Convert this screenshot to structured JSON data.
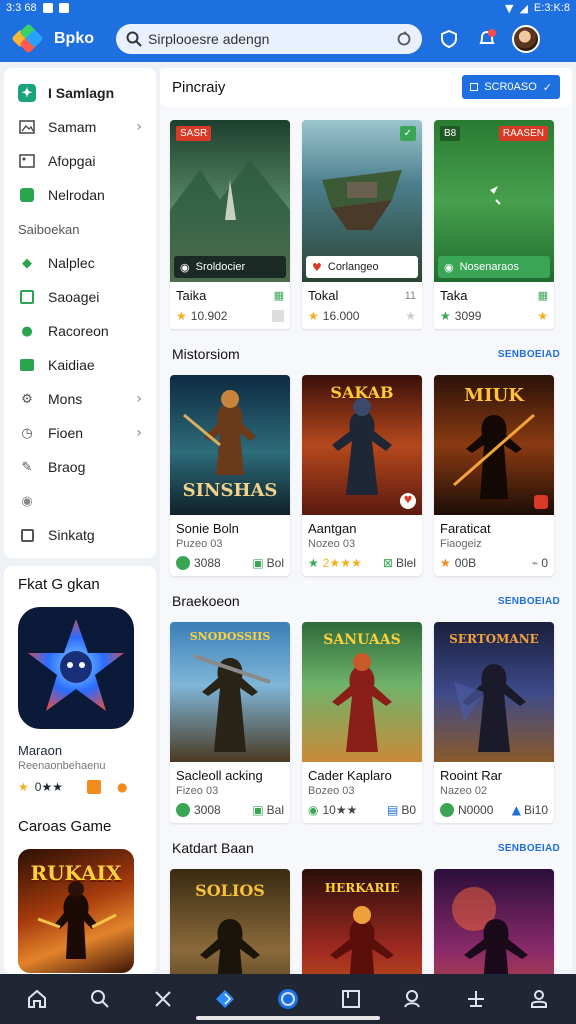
{
  "status_bar": {
    "time": "3:3 68",
    "right_text": "E:3:K:8"
  },
  "app": {
    "name": "Bpko",
    "search": {
      "value": "Sirplooesre adengn"
    }
  },
  "sidebar": {
    "items": [
      {
        "label": "I Samlagn",
        "icon": "home-grid-icon"
      },
      {
        "label": "Samam",
        "icon": "image-icon",
        "chevron": true
      },
      {
        "label": "Afopgai",
        "icon": "gallery-icon"
      },
      {
        "label": "Nelrodan",
        "icon": "green-square-icon"
      }
    ],
    "section_heading": "Saiboekan",
    "items2": [
      {
        "label": "Nalplec",
        "icon": "leaf-icon"
      },
      {
        "label": "Saoagei",
        "icon": "chart-icon"
      },
      {
        "label": "Racoreon",
        "icon": "refresh-icon"
      },
      {
        "label": "Kaidiae",
        "icon": "bar-icon"
      },
      {
        "label": "Mons",
        "icon": "gear-icon",
        "chevron": true
      },
      {
        "label": "Fioen",
        "icon": "clock-icon",
        "chevron": true
      },
      {
        "label": "Braog",
        "icon": "edit-icon"
      },
      {
        "label": "",
        "icon": "dot-icon"
      },
      {
        "label": "Sinkatg",
        "icon": "tag-icon"
      }
    ]
  },
  "promo": {
    "heading1": "Fkat G gkan",
    "app_name": "Maraon",
    "app_sub": "Reenaonbehaenu",
    "app_rating": "0★★",
    "heading2": "Caroas Game",
    "art2_text": "RUKAIX"
  },
  "main": {
    "top_title": "Pincraiy",
    "filter_label": "SCR0ASO",
    "featured": [
      {
        "pill": "Sroldocier",
        "title": "Taika",
        "rating": "10.902",
        "tag": "SASR",
        "colors": [
          "#1d3f2e",
          "#5a8a66",
          "#c9b67e"
        ]
      },
      {
        "pill": "Corlangeo",
        "title": "Tokal",
        "rating": "16.000",
        "tag": "",
        "colors": [
          "#1d3340",
          "#6e9fa0",
          "#3a5030"
        ]
      },
      {
        "pill": "Nosenaraos",
        "title": "Taka",
        "rating": "3099",
        "tag": "B8",
        "tag2": "RAASEN",
        "colors": [
          "#1f6d2e",
          "#47a04d",
          "#2a7b32"
        ]
      }
    ],
    "sections": [
      {
        "title": "Mistorsiom",
        "link": "SENBOEIAD",
        "cards": [
          {
            "title": "Sonie Boln",
            "sub": "Puzeo 03",
            "left": "3088",
            "right": "Bol",
            "art_text": "SINSHAS",
            "colors": [
              "#0f2a40",
              "#2d6c7a",
              "#10202a"
            ]
          },
          {
            "title": "Aantgan",
            "sub": "Nozeo 03",
            "left": "2★★★",
            "right": "Blel",
            "art_text": "SAKAB",
            "colors": [
              "#3a0f0a",
              "#b5481d",
              "#5b1a10"
            ]
          },
          {
            "title": "Faraticat",
            "sub": "Fiaogeiz",
            "left": "00B",
            "right": "0",
            "art_text": "MIUK",
            "colors": [
              "#2a1208",
              "#8a3a12",
              "#1c0d06"
            ]
          }
        ]
      },
      {
        "title": "Braekoeon",
        "link": "SENBOEIAD",
        "cards": [
          {
            "title": "Sacleoll acking",
            "sub": "Fizeo 03",
            "left": "3008",
            "right": "Bal",
            "art_text": "SNODOSSIIS",
            "colors": [
              "#3b7fb7",
              "#7fb6d9",
              "#4a3a22"
            ]
          },
          {
            "title": "Cader Kaplaro",
            "sub": "Bozeo 03",
            "left": "10★★",
            "right": "B0",
            "art_text": "SANUAAS",
            "colors": [
              "#2d6a3a",
              "#6fb36a",
              "#c98a3a"
            ]
          },
          {
            "title": "Rooint Rar",
            "sub": "Nazeo 02",
            "left": "N0000",
            "right": "Bi10",
            "art_text": "SERTOMANE",
            "colors": [
              "#1a1f3a",
              "#3d4a8a",
              "#8a5a2a"
            ]
          }
        ]
      },
      {
        "title": "Katdart Baan",
        "link": "SENBOEIAD",
        "cards": [
          {
            "art_text": "SOLIOS",
            "colors": [
              "#3a2a12",
              "#8a6a3a",
              "#2a2010"
            ]
          },
          {
            "art_text": "HERKARIE",
            "colors": [
              "#2a0f0a",
              "#a02a20",
              "#d0701a"
            ]
          },
          {
            "art_text": "",
            "colors": [
              "#2a0f3a",
              "#8a2a6a",
              "#d05a2a"
            ]
          }
        ]
      }
    ]
  },
  "bottom_nav": [
    "home-icon",
    "search-icon",
    "close-icon",
    "diamond-icon",
    "circle-icon",
    "window-icon",
    "user-search-icon",
    "plus-icon",
    "person-icon"
  ]
}
